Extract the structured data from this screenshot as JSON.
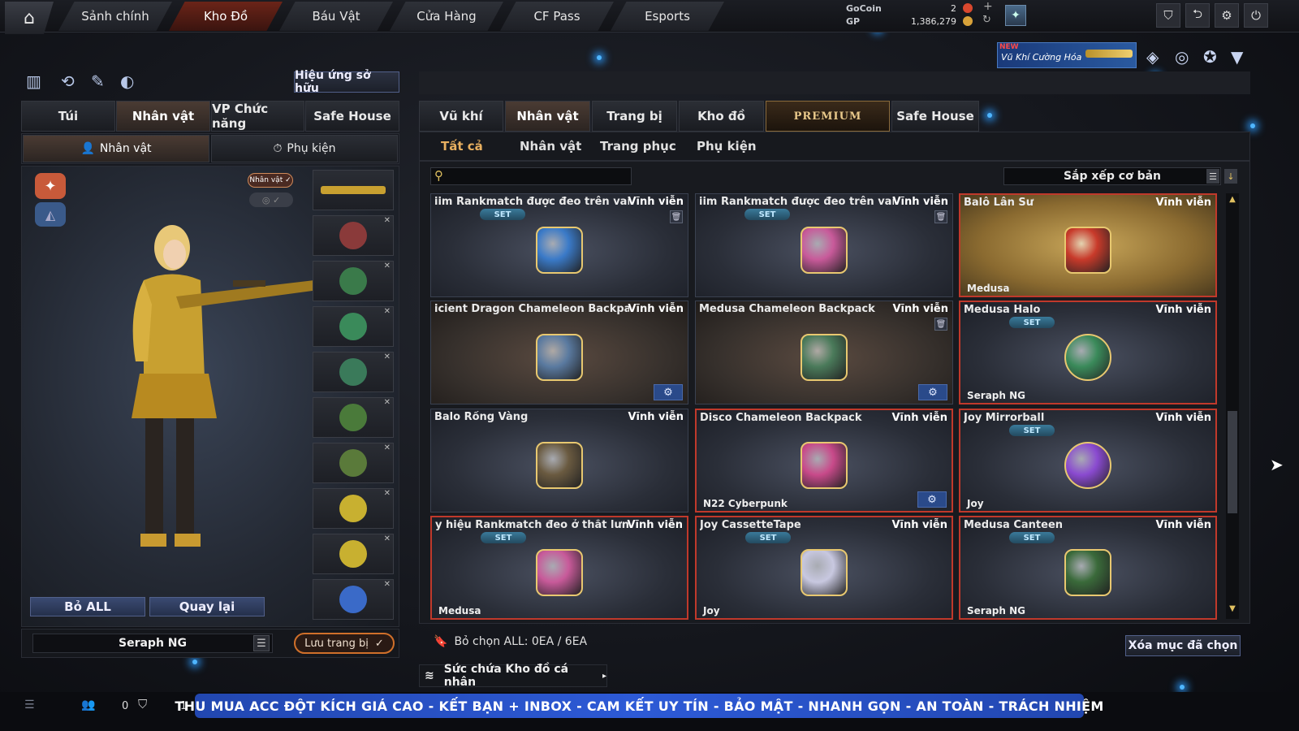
{
  "topnav": {
    "tabs": [
      "Sảnh chính",
      "Kho Đồ",
      "Báu Vật",
      "Cửa Hàng",
      "CF Pass",
      "Esports"
    ],
    "active_index": 1,
    "gocoin_label": "GoCoin",
    "gocoin_value": "2",
    "gp_label": "GP",
    "gp_value": "1,386,279",
    "promo_new": "NEW",
    "promo_text": "Vũ Khí Cường Hóa"
  },
  "left": {
    "owned_effects": "Hiệu ứng sở hữu",
    "tabs": [
      "Túi",
      "Nhân vật",
      "VP Chức năng",
      "Safe House"
    ],
    "active_tab": 1,
    "subtabs": [
      "Nhân vật",
      "Phụ kiện"
    ],
    "active_subtab": 0,
    "char_badge": "Nhân vật ✓",
    "slot_count": 10,
    "remove_all": "Bỏ ALL",
    "back": "Quay lại",
    "character_name": "Seraph NG",
    "save_equip": "Lưu trang bị"
  },
  "inventory": {
    "tabs": [
      "Vũ khí",
      "Nhân vật",
      "Trang bị",
      "Kho đồ",
      "PREMIUM",
      "Safe House"
    ],
    "active_tab": 1,
    "subtabs": [
      "Tất cả",
      "Nhân vật",
      "Trang phục",
      "Phụ kiện"
    ],
    "active_subtab": 0,
    "search_placeholder": "",
    "sort_label": "Sắp xếp cơ bản",
    "items": [
      {
        "name": "iim Rankmatch được đeo trên vai",
        "duration": "Vĩnh viễn",
        "set": "SET",
        "owner": "",
        "style": "normal",
        "trash": true,
        "gear": false,
        "icon": "badge-blue-icon"
      },
      {
        "name": "iim Rankmatch được đeo trên vai",
        "duration": "Vĩnh viễn",
        "set": "SET",
        "owner": "",
        "style": "normal",
        "trash": true,
        "gear": false,
        "icon": "badge-pink-icon"
      },
      {
        "name": "Balô Lân Sư",
        "duration": "Vĩnh viễn",
        "set": "",
        "owner": "Medusa",
        "style": "gold",
        "trash": false,
        "gear": false,
        "icon": "lion-backpack-icon"
      },
      {
        "name": "icient Dragon Chameleon Backpack",
        "duration": "Vĩnh viễn",
        "set": "",
        "owner": "",
        "style": "brown",
        "trash": false,
        "gear": true,
        "icon": "backpack-icon"
      },
      {
        "name": "Medusa Chameleon Backpack",
        "duration": "Vĩnh viễn",
        "set": "",
        "owner": "",
        "style": "brown",
        "trash": true,
        "gear": true,
        "icon": "backpack-green-icon"
      },
      {
        "name": "Medusa Halo",
        "duration": "Vĩnh viễn",
        "set": "SET",
        "owner": "Seraph NG",
        "style": "red",
        "trash": false,
        "gear": false,
        "icon": "halo-icon"
      },
      {
        "name": "Balo Rồng Vàng",
        "duration": "Vĩnh viễn",
        "set": "",
        "owner": "",
        "style": "normal",
        "trash": false,
        "gear": false,
        "icon": "dragon-backpack-icon"
      },
      {
        "name": "Disco Chameleon Backpack",
        "duration": "Vĩnh viễn",
        "set": "",
        "owner": "N22 Cyberpunk",
        "style": "red",
        "trash": false,
        "gear": true,
        "icon": "disco-backpack-icon"
      },
      {
        "name": "Joy Mirrorball",
        "duration": "Vĩnh viễn",
        "set": "SET",
        "owner": "Joy",
        "style": "red",
        "trash": false,
        "gear": false,
        "icon": "mirrorball-icon"
      },
      {
        "name": "y hiệu Rankmatch đeo ở thắt lưng",
        "duration": "Vĩnh viễn",
        "set": "SET",
        "owner": "Medusa",
        "style": "red",
        "trash": false,
        "gear": false,
        "icon": "badge-pink-icon"
      },
      {
        "name": "Joy CassetteTape",
        "duration": "Vĩnh viễn",
        "set": "SET",
        "owner": "Joy",
        "style": "red",
        "trash": false,
        "gear": false,
        "icon": "cassette-icon"
      },
      {
        "name": "Medusa Canteen",
        "duration": "Vĩnh viễn",
        "set": "SET",
        "owner": "Seraph NG",
        "style": "red",
        "trash": false,
        "gear": false,
        "icon": "canteen-icon"
      }
    ],
    "deselect_all": "Bỏ chọn ALL: 0EA / 6EA",
    "delete_selected": "Xóa mục đã chọn",
    "capacity": "Sức chứa Kho đồ cá nhân"
  },
  "bottom": {
    "count_a": "0",
    "count_b": "1",
    "banner": "THU MUA ACC ĐỘT KÍCH GIÁ CAO  -  KẾT BẠN + INBOX  -  CAM KẾT UY TÍN - BẢO MẬT - NHANH GỌN - AN TOÀN - TRÁCH NHIỆM"
  },
  "colors": {
    "accent_red": "#c0392b",
    "accent_gold": "#e8b060",
    "banner_blue": "#2d5ad6",
    "set_badge": "#3a7a9a"
  }
}
